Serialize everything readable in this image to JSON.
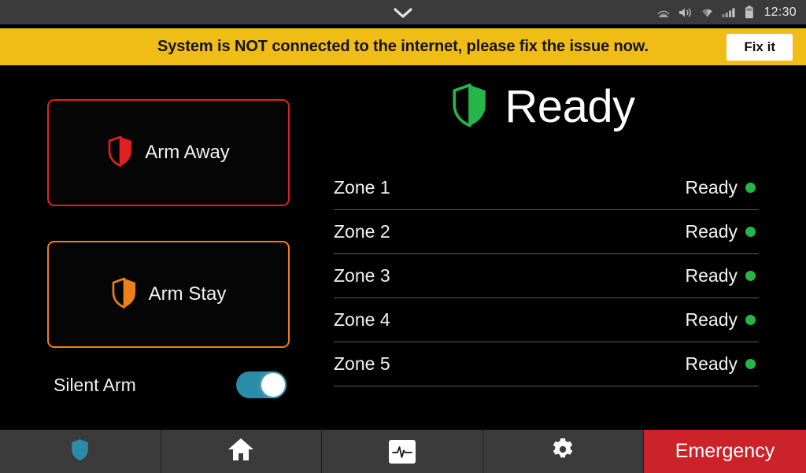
{
  "statusbar": {
    "chevron_icon": "chevron-down-icon",
    "icons": [
      "cast-icon",
      "volume-icon",
      "wifi-icon",
      "cellular-signal-icon",
      "battery-icon"
    ],
    "time": "12:30"
  },
  "banner": {
    "message": "System is NOT connected to the internet, please fix the issue now.",
    "action_label": "Fix it",
    "background_color": "#f0bd16",
    "text_color": "#141414"
  },
  "left_panel": {
    "arm_away": {
      "label": "Arm Away",
      "icon": "shield-icon",
      "accent_color": "#e02020"
    },
    "arm_stay": {
      "label": "Arm Stay",
      "icon": "shield-icon",
      "accent_color": "#ef8019"
    },
    "silent_arm": {
      "label": "Silent Arm",
      "state": "on",
      "toggle_color": "#2b8caa"
    }
  },
  "status_panel": {
    "state_label": "Ready",
    "state_icon": "shield-icon",
    "state_color": "#25b64a",
    "zones": [
      {
        "name": "Zone 1",
        "status": "Ready",
        "indicator_color": "#25b64a"
      },
      {
        "name": "Zone 2",
        "status": "Ready",
        "indicator_color": "#25b64a"
      },
      {
        "name": "Zone 3",
        "status": "Ready",
        "indicator_color": "#25b64a"
      },
      {
        "name": "Zone 4",
        "status": "Ready",
        "indicator_color": "#25b64a"
      },
      {
        "name": "Zone 5",
        "status": "Ready",
        "indicator_color": "#25b64a"
      }
    ]
  },
  "navbar": {
    "items": [
      {
        "icon": "shield-icon",
        "name": "security",
        "active": true
      },
      {
        "icon": "home-icon",
        "name": "home",
        "active": false
      },
      {
        "icon": "activity-pulse-icon",
        "name": "activity",
        "active": false
      },
      {
        "icon": "gear-icon",
        "name": "settings",
        "active": false
      }
    ],
    "emergency_label": "Emergency",
    "emergency_color": "#cc2229",
    "active_icon_color": "#2b8caa"
  }
}
